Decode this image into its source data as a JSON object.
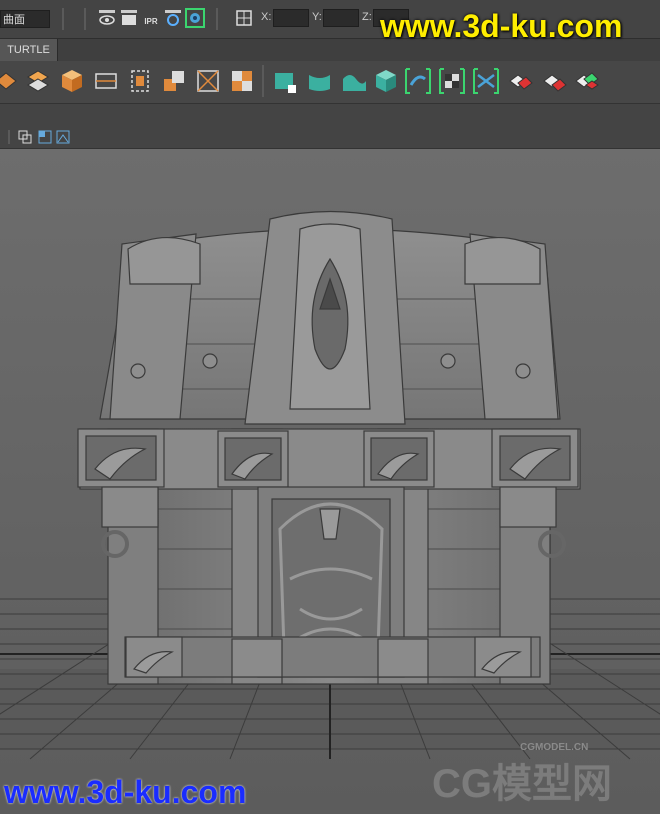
{
  "toolbar": {
    "mode_label": "曲面",
    "ipr_label": "IPR",
    "coords": {
      "x_label": "X:",
      "y_label": "Y:",
      "z_label": "Z:",
      "x_value": "",
      "y_value": "",
      "z_value": ""
    }
  },
  "tabs": [
    {
      "label": "TURTLE"
    }
  ],
  "shelf": {
    "icons": [
      "plane-quad-icon",
      "diamond-grid-icon",
      "cube-orange-icon",
      "bounding-box-icon",
      "frame-box-icon",
      "split-cube-icon",
      "square-cross-icon",
      "checker-squares-icon",
      "green-surface-icon",
      "green-curve-icon",
      "green-wave-icon",
      "green-cube-icon",
      "green-bracket-curve-icon",
      "green-bracket-checker-icon",
      "green-bracket-cross-icon",
      "red-tiles-icon",
      "red-tiles-2-icon",
      "green-tiles-icon"
    ]
  },
  "watermarks": {
    "top": "www.3d-ku.com",
    "bottom": "www.3d-ku.com",
    "cg_small": "CGMODEL.CN",
    "cg_big": "CG模型网"
  },
  "colors": {
    "ui_bg": "#444444",
    "viewport_bg": "#6e6e6e",
    "accent_green": "#3bd56f",
    "watermark_yellow": "#ffee00",
    "watermark_blue": "#1a2cff"
  }
}
